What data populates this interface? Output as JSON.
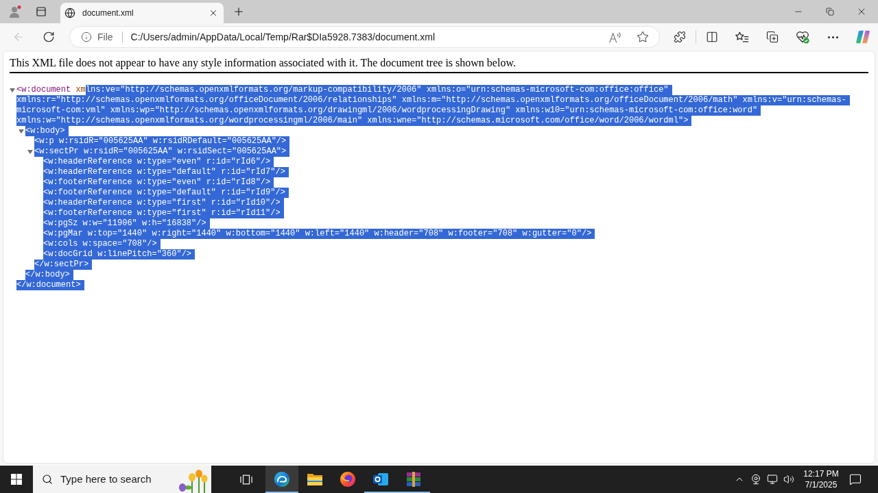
{
  "browser": {
    "tabs": [
      {
        "title": "document.xml",
        "selected": true
      }
    ],
    "back_button": {
      "disabled": true
    },
    "address_bar": {
      "site_info": "File",
      "url": "C:/Users/admin/AppData/Local/Temp/Rar$DIa5928.7383/document.xml"
    }
  },
  "page": {
    "notice": "This XML file does not appear to have any style information associated with it. The document tree is shown below.",
    "tree": {
      "start": [
        [
          {
            "text": "<w:document",
            "kind": "tag",
            "selected": false
          },
          {
            "text": " xm",
            "kind": "attribute",
            "selected": false
          },
          {
            "text": "lns:ve=\"http://schemas.openxmlformats.org/markup-compatibility/2006\" xmlns:o=\"urn:schemas-microsoft-com:office:office\"",
            "selected": true
          }
        ],
        [
          {
            "text": "xmlns:r=\"http://schemas.openxmlformats.org/officeDocument/2006/relationships\" xmlns:m=\"http://schemas.openxmlformats.org/officeDocument/2006/math\" xmlns:v=\"urn:schemas-",
            "selected": true
          }
        ],
        [
          {
            "text": "microsoft-com:vml\" xmlns:wp=\"http://schemas.openxmlformats.org/drawingml/2006/wordprocessingDrawing\" xmlns:w10=\"urn:schemas-microsoft-com:office:word\"",
            "selected": true
          }
        ],
        [
          {
            "text": "xmlns:w=\"http://schemas.openxmlformats.org/wordprocessingml/2006/main\" xmlns:wne=\"http://schemas.microsoft.com/office/word/2006/wordml\">",
            "selected": true
          }
        ]
      ],
      "expanded": true,
      "children": [
        {
          "start": [
            [
              {
                "text": "<w:body>",
                "selected": true
              }
            ]
          ],
          "expanded": true,
          "children": [
            {
              "start": [
                [
                  {
                    "text": "<w:p w:rsidR=\"005625AA\" w:rsidRDefault=\"005625AA\"/>",
                    "selected": true
                  }
                ]
              ]
            },
            {
              "start": [
                [
                  {
                    "text": "<w:sectPr w:rsidR=\"005625AA\" w:rsidSect=\"005625AA\">",
                    "selected": true
                  }
                ]
              ],
              "expanded": true,
              "children": [
                {
                  "start": [
                    [
                      {
                        "text": "<w:headerReference w:type=\"even\" r:id=\"rId6\"/>",
                        "selected": true
                      }
                    ]
                  ]
                },
                {
                  "start": [
                    [
                      {
                        "text": "<w:headerReference w:type=\"default\" r:id=\"rId7\"/>",
                        "selected": true
                      }
                    ]
                  ]
                },
                {
                  "start": [
                    [
                      {
                        "text": "<w:footerReference w:type=\"even\" r:id=\"rId8\"/>",
                        "selected": true
                      }
                    ]
                  ]
                },
                {
                  "start": [
                    [
                      {
                        "text": "<w:footerReference w:type=\"default\" r:id=\"rId9\"/>",
                        "selected": true
                      }
                    ]
                  ]
                },
                {
                  "start": [
                    [
                      {
                        "text": "<w:headerReference w:type=\"first\" r:id=\"rId10\"/>",
                        "selected": true
                      }
                    ]
                  ]
                },
                {
                  "start": [
                    [
                      {
                        "text": "<w:footerReference w:type=\"first\" r:id=\"rId11\"/>",
                        "selected": true
                      }
                    ]
                  ]
                },
                {
                  "start": [
                    [
                      {
                        "text": "<w:pgSz w:w=\"11906\" w:h=\"16838\"/>",
                        "selected": true
                      }
                    ]
                  ]
                },
                {
                  "start": [
                    [
                      {
                        "text": "<w:pgMar w:top=\"1440\" w:right=\"1440\" w:bottom=\"1440\" w:left=\"1440\" w:header=\"708\" w:footer=\"708\" w:gutter=\"0\"/>",
                        "selected": true
                      }
                    ]
                  ]
                },
                {
                  "start": [
                    [
                      {
                        "text": "<w:cols w:space=\"708\"/>",
                        "selected": true
                      }
                    ]
                  ]
                },
                {
                  "start": [
                    [
                      {
                        "text": "<w:docGrid w:linePitch=\"360\"/>",
                        "selected": true
                      }
                    ]
                  ]
                }
              ],
              "end": [
                {
                  "text": "</w:sectPr>",
                  "selected": true
                }
              ]
            }
          ],
          "end": [
            {
              "text": "</w:body>",
              "selected": true
            }
          ]
        }
      ],
      "end": [
        {
          "text": "</w:document>",
          "selected": true
        }
      ]
    }
  },
  "taskbar": {
    "search": {
      "placeholder": "Type here to search"
    },
    "apps": [
      {
        "kind": "edge",
        "running": true,
        "active": true
      },
      {
        "kind": "file_explorer",
        "running": false,
        "active": false
      },
      {
        "kind": "firefox",
        "running": false,
        "active": false
      },
      {
        "kind": "outlook",
        "running": true,
        "active": false
      },
      {
        "kind": "winrar",
        "running": true,
        "active": false
      }
    ],
    "clock": {
      "time": "12:17 PM",
      "date": "7/1/2025"
    }
  }
}
